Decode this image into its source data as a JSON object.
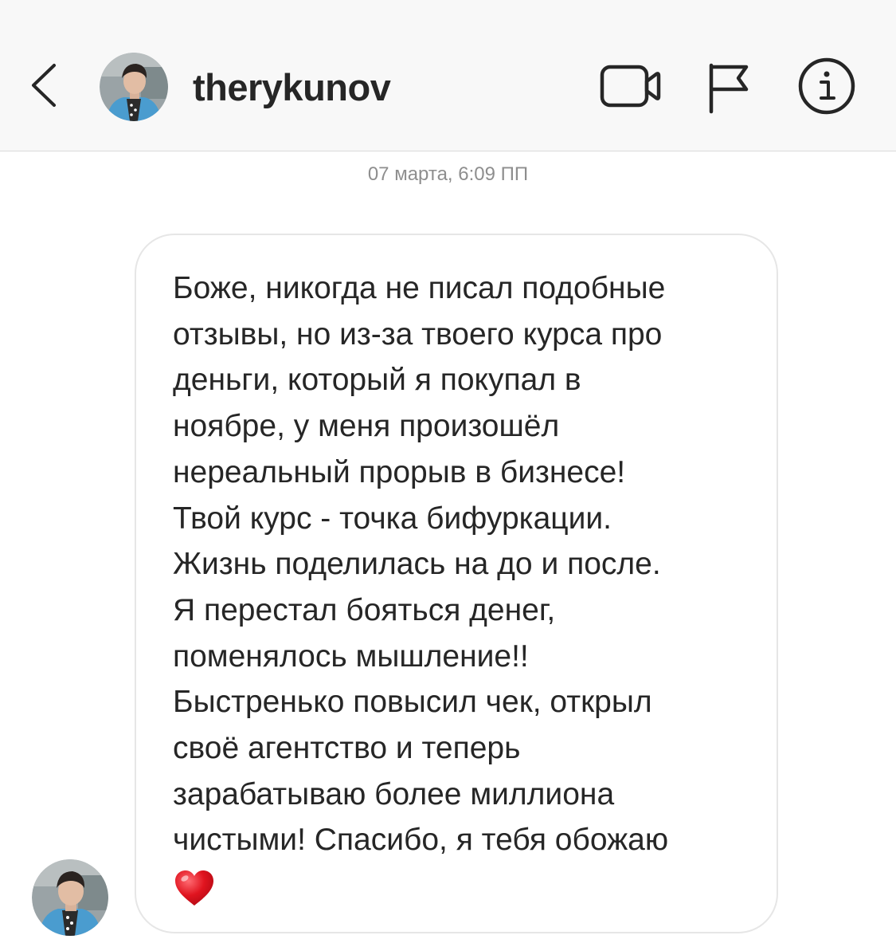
{
  "header": {
    "username": "therykunov",
    "back_icon": "chevron-left-icon",
    "avatar_icon": "profile-photo",
    "actions": [
      "video-call-icon",
      "flag-icon",
      "info-icon"
    ]
  },
  "thread": {
    "timestamp": "07 марта, 6:09 ПП",
    "message": {
      "lines": [
        "Боже, никогда не писал подобные",
        "отзывы, но из-за твоего курса про",
        "деньги, который я покупал в",
        "ноябре, у меня произошёл",
        "нереальный прорыв в бизнесе!",
        "Твой курс - точка бифуркации.",
        "Жизнь поделилась на до и после.",
        "Я перестал бояться денег,",
        "поменялось мышление!!",
        "Быстренько повысил чек, открыл",
        "своё агентство и теперь",
        "зарабатываю более миллиона",
        "чистыми! Спасибо, я тебя обожаю"
      ],
      "emoji": "heart-icon"
    }
  },
  "colors": {
    "header_bg": "#f8f8f8",
    "text": "#262626",
    "muted": "#8e8e8e",
    "bubble_border": "#e6e6e6",
    "heart": "#e0141f"
  }
}
